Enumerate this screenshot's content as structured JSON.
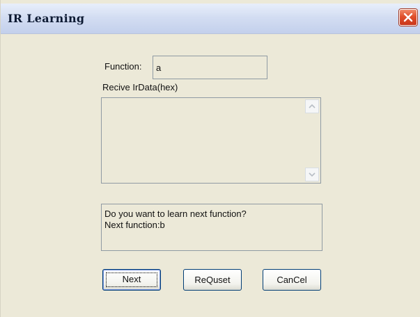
{
  "window": {
    "title": "IR Learning"
  },
  "function_field": {
    "label": "Function:",
    "value": "a"
  },
  "ir_data": {
    "label": "Recive IrData(hex)",
    "value": ""
  },
  "message": {
    "line1": "Do you want to learn next function?",
    "line2": "Next function:b"
  },
  "buttons": {
    "next": "Next",
    "requset": "ReQuset",
    "cancel": "CanCel"
  },
  "colors": {
    "window_bg": "#ece9d8",
    "close_button": "#e0502c",
    "button_border": "#003c74"
  },
  "icons": [
    "close-icon",
    "scroll-up-arrow-icon",
    "scroll-down-arrow-icon"
  ]
}
